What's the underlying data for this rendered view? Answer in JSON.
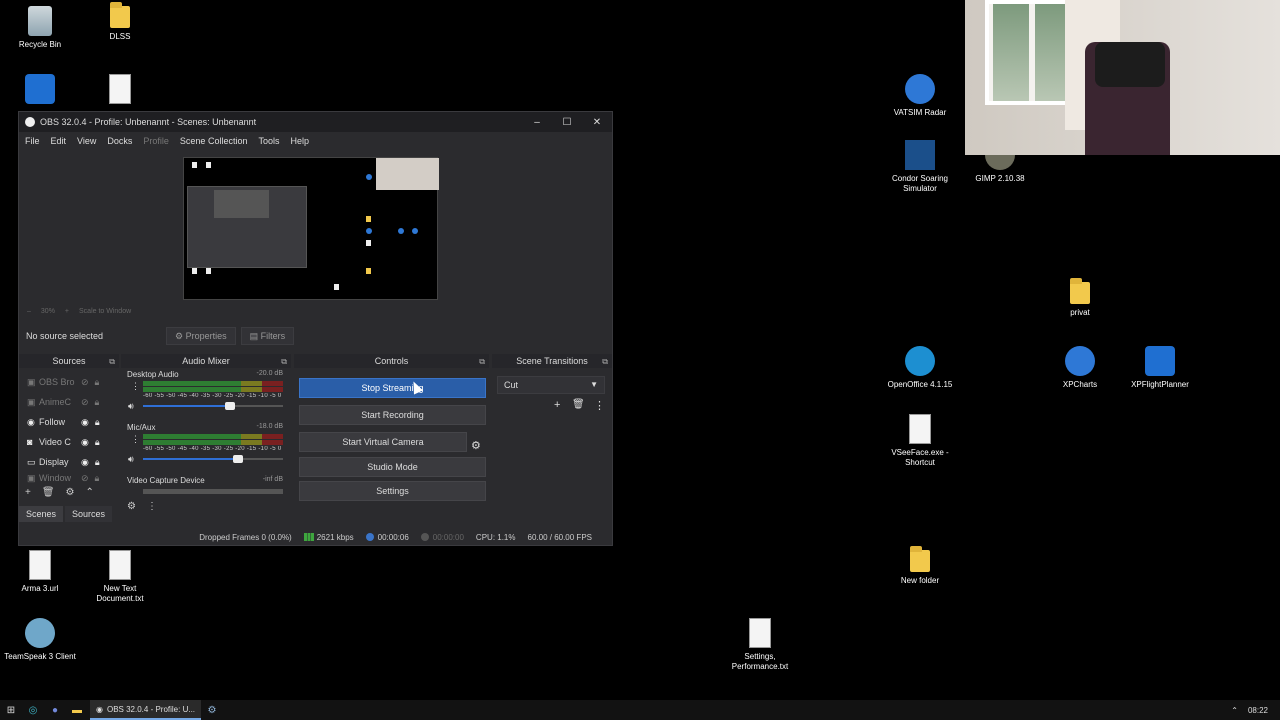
{
  "desktop": {
    "icons": [
      {
        "label": "Recycle Bin",
        "icon": "recycle-bin-icon"
      },
      {
        "label": "DLSS",
        "icon": "folder-icon"
      },
      {
        "label": "VATSIM Radar",
        "icon": "vatsim-radar-icon"
      },
      {
        "label": "Condor Soaring Simulator",
        "icon": "condor-icon"
      },
      {
        "label": "GIMP 2.10.38",
        "icon": "gimp-icon"
      },
      {
        "label": "privat",
        "icon": "folder-icon"
      },
      {
        "label": "OpenOffice 4.1.15",
        "icon": "openoffice-icon"
      },
      {
        "label": "XPCharts",
        "icon": "xpcharts-icon"
      },
      {
        "label": "XPFlightPlanner",
        "icon": "xpflightplanner-icon"
      },
      {
        "label": "VSeeFace.exe - Shortcut",
        "icon": "file-icon"
      },
      {
        "label": "Arma 3.url",
        "icon": "file-icon"
      },
      {
        "label": "New Text Document.txt",
        "icon": "file-icon"
      },
      {
        "label": "TeamSpeak 3 Client",
        "icon": "teamspeak-icon"
      },
      {
        "label": "New folder",
        "icon": "folder-icon"
      },
      {
        "label": "Settings, Performance.txt",
        "icon": "file-icon"
      }
    ]
  },
  "obs": {
    "title": "OBS 32.0.4 - Profile: Unbenannt - Scenes: Unbenannt",
    "window_buttons": {
      "minimize": "–",
      "maximize": "☐",
      "close": "✕"
    },
    "menu": [
      "File",
      "Edit",
      "View",
      "Docks",
      "Profile",
      "Scene Collection",
      "Tools",
      "Help"
    ],
    "zoom": {
      "minus": "–",
      "value": "30%",
      "plus": "+",
      "mode": "Scale to Window"
    },
    "no_source": "No source selected",
    "properties_label": "Properties",
    "filters_label": "Filters",
    "docks": {
      "sources": "Sources",
      "mixer": "Audio Mixer",
      "controls": "Controls",
      "transitions": "Scene Transitions"
    },
    "sources": [
      {
        "name": "OBS Bro",
        "icon": "▣",
        "dim": true
      },
      {
        "name": "AnimeC",
        "icon": "▣",
        "dim": true
      },
      {
        "name": "Follow",
        "icon": "◉",
        "dim": false
      },
      {
        "name": "Video C",
        "icon": "◙",
        "dim": false
      },
      {
        "name": "Display",
        "icon": "▭",
        "dim": false
      },
      {
        "name": "Window",
        "icon": "▣",
        "dim": true
      }
    ],
    "mixer": {
      "scale": "-60 -55 -50 -45 -40 -35 -30 -25 -20 -15 -10 -5 0",
      "channels": [
        {
          "name": "Desktop Audio",
          "db": "-20.0 dB",
          "volume": 0.62
        },
        {
          "name": "Mic/Aux",
          "db": "-18.0 dB",
          "volume": 0.68
        },
        {
          "name": "Video Capture Device",
          "db": "-inf dB",
          "volume": 0.0
        }
      ]
    },
    "controls": {
      "stop_streaming": "Stop Streaming",
      "start_recording": "Start Recording",
      "start_virtual_camera": "Start Virtual Camera",
      "studio_mode": "Studio Mode",
      "settings": "Settings"
    },
    "transitions": {
      "selected": "Cut"
    },
    "tabs": [
      "Scenes",
      "Sources"
    ],
    "status": {
      "dropped": "Dropped Frames 0 (0.0%)",
      "bitrate": "2621 kbps",
      "stream_time": "00:00:06",
      "rec_time": "00:00:00",
      "cpu": "CPU: 1.1%",
      "fps": "60.00 / 60.00 FPS"
    }
  },
  "taskbar": {
    "task_label": "OBS 32.0.4 - Profile: U...",
    "clock": "08:22"
  }
}
